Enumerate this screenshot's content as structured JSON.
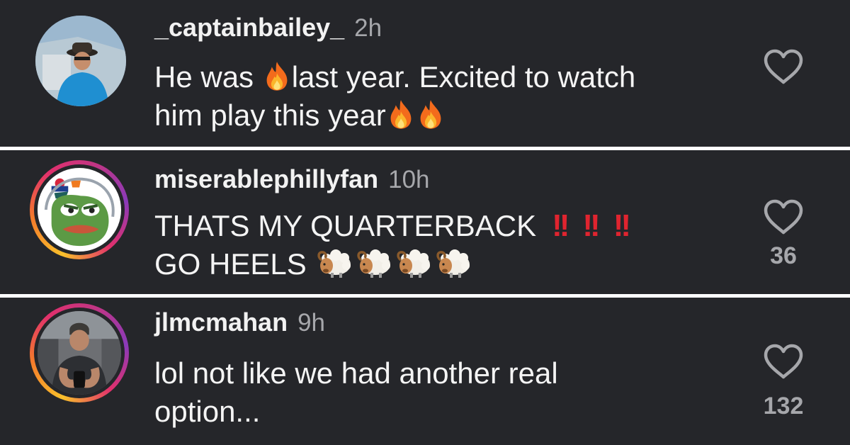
{
  "comments": [
    {
      "username": "_captainbailey_",
      "time": "2h",
      "text_parts": [
        "He was ",
        "last year. Excited to watch",
        "him play this year"
      ],
      "likes": ""
    },
    {
      "username": "miserablephillyfan",
      "time": "10h",
      "text_parts": [
        "THATS MY QUARTERBACK",
        "!!",
        "!!",
        "!!",
        "GO HEELS"
      ],
      "likes": "36"
    },
    {
      "username": "jlmcmahan",
      "time": "9h",
      "text_parts": [
        "lol not like we had another real",
        "option..."
      ],
      "likes": "132"
    }
  ],
  "icons": {
    "like": "heart-outline-icon",
    "fire": "fire-emoji",
    "ram": "ram-emoji",
    "exclamation": "double-exclamation-emoji"
  },
  "colors": {
    "background": "#25262a",
    "text": "#f4f4f4",
    "muted": "#a6a7ab",
    "exclamation": "#e0242f"
  }
}
